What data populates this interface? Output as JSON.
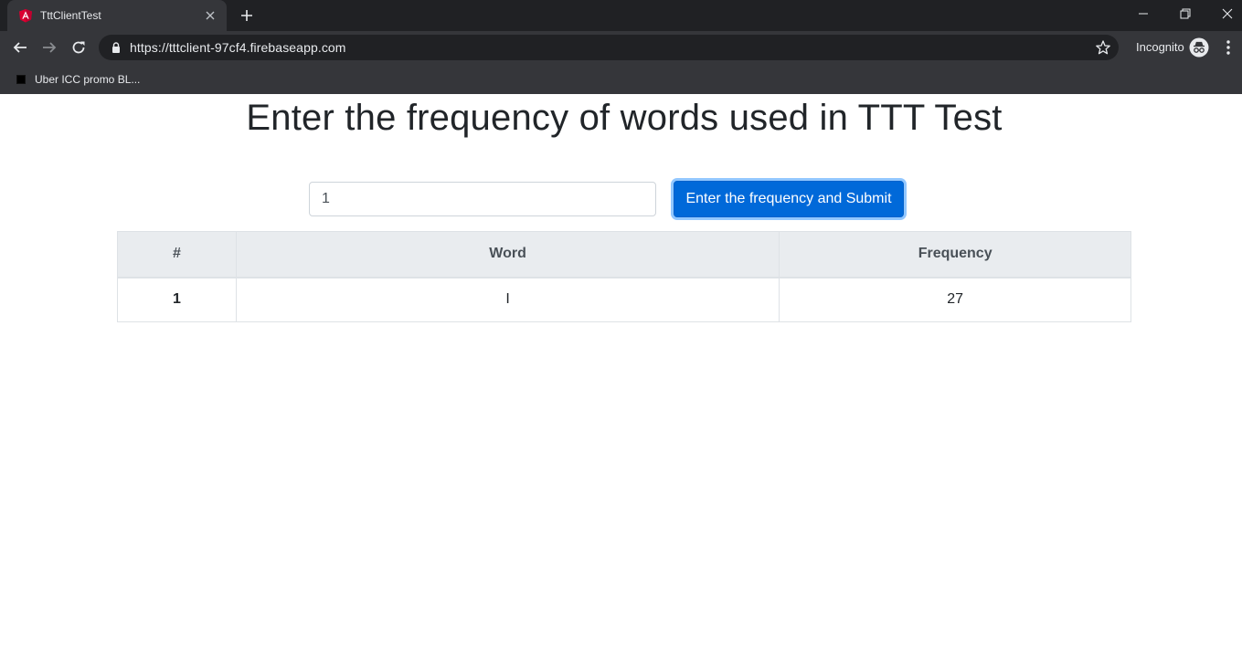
{
  "browser": {
    "tab_title": "TttClientTest",
    "favicon_icon": "angular-icon",
    "url": "https://tttclient-97cf4.firebaseapp.com",
    "incognito_label": "Incognito",
    "bookmark_label": "Uber ICC promo BL..."
  },
  "page": {
    "title": "Enter the frequency of words used in TTT Test",
    "input_value": "1",
    "submit_label": "Enter the frequency and Submit"
  },
  "table": {
    "headers": [
      "#",
      "Word",
      "Frequency"
    ],
    "rows": [
      {
        "index": "1",
        "word": "I",
        "frequency": "27"
      }
    ]
  },
  "colors": {
    "primary": "#0069d9",
    "header_bg": "#e9ecef",
    "chrome_dark": "#202124",
    "chrome_toolbar": "#35363a"
  }
}
